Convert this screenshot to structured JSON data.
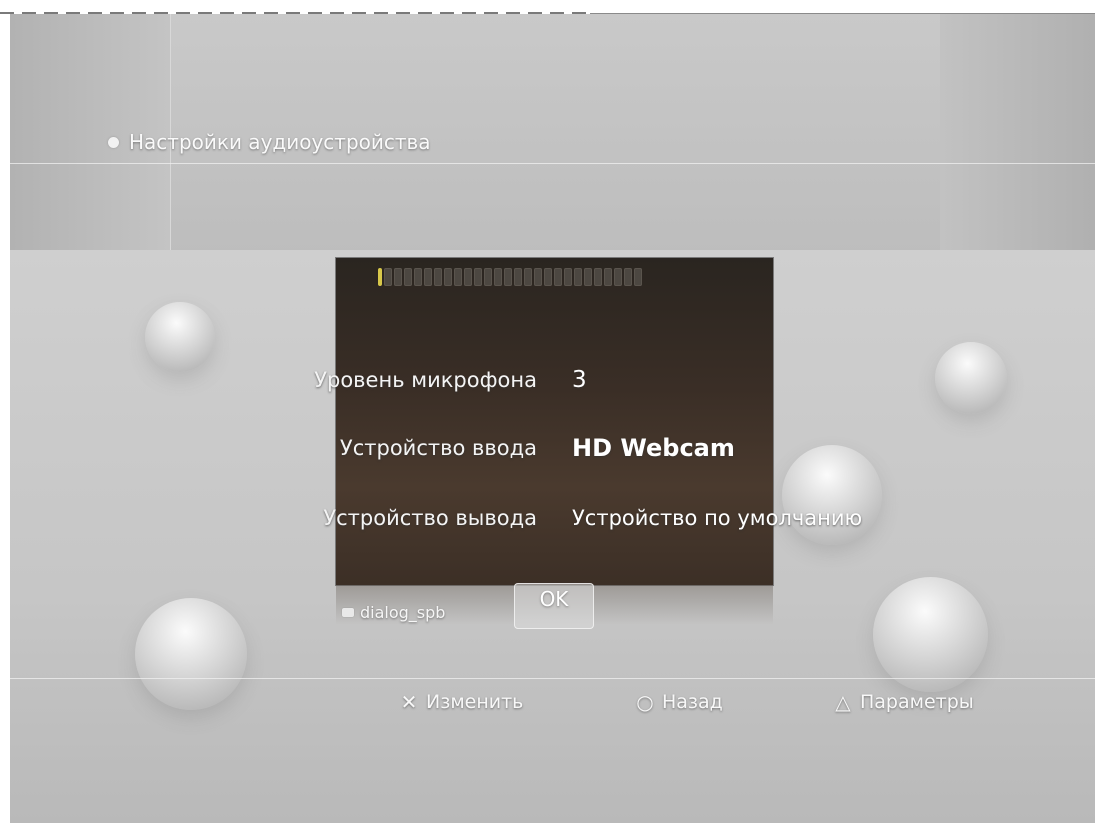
{
  "header": {
    "title": "Настройки аудиоустройства"
  },
  "level_meter": {
    "active_fraction": 0.03,
    "segments": 27,
    "active_color": "#d8c84a"
  },
  "settings": [
    {
      "label": "Уровень микрофона",
      "value": "3"
    },
    {
      "label": "Устройство ввода",
      "value": "HD Webcam"
    },
    {
      "label": "Устройство вывода",
      "value": "Устройство по умолчанию"
    }
  ],
  "dialog": {
    "name": "dialog_spb",
    "ok_label": "OK"
  },
  "footer": {
    "buttons": [
      {
        "icon": "cross-icon",
        "glyph": "✕",
        "label": "Изменить"
      },
      {
        "icon": "circle-icon",
        "glyph": "○",
        "label": "Назад"
      },
      {
        "icon": "triangle-icon",
        "glyph": "△",
        "label": "Параметры"
      }
    ]
  }
}
